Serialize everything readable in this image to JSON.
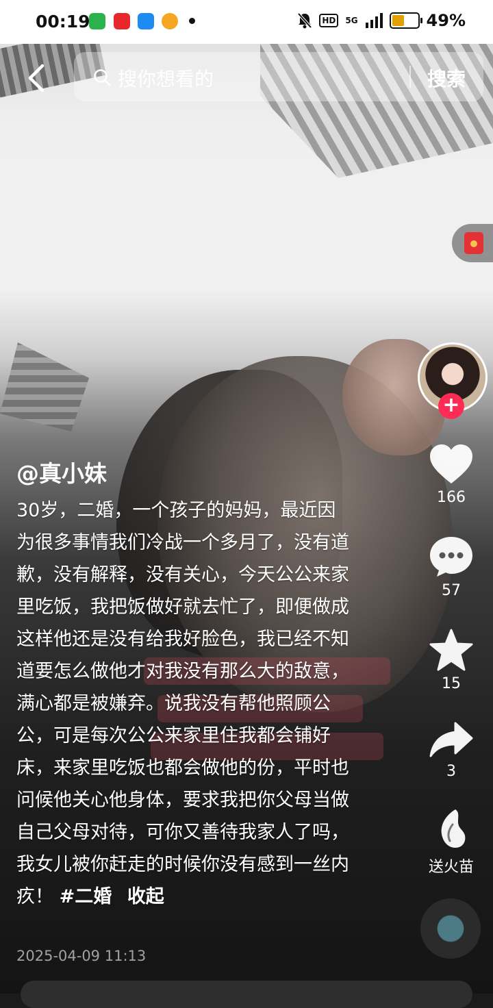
{
  "status_bar": {
    "time": "00:19",
    "network": "5G",
    "hd": "HD",
    "battery": "49%",
    "battery_level": 0.49
  },
  "search": {
    "placeholder": "搜你想看的",
    "button": "搜索"
  },
  "post": {
    "author": "@真小妹",
    "text": "30岁，二婚，一个孩子的妈妈，最近因为很多事情我们冷战一个多月了，没有道歉，没有解释，没有关心，今天公公来家里吃饭，我把饭做好就去忙了，即便做成这样他还是没有给我好脸色，我已经不知道要怎么做他才对我没有那么大的敌意，满心都是被嫌弃。说我没有帮他照顾公公，可是每次公公来家里住我都会铺好床，来家里吃饭也都会做他的份，平时也问候他关心他身体，要求我把你父母当做自己父母对待，可你又善待我家人了吗，我女儿被你赶走的时候你没有感到一丝内疚！",
    "hashtag": "#二婚",
    "collapse": "收起",
    "date": "2025-04-09 11:13"
  },
  "actions": {
    "likes": "166",
    "comments": "57",
    "favorites": "15",
    "shares": "3",
    "fire_label": "送火苗"
  },
  "colors": {
    "follow": "#fe2c55",
    "red_packet": "#e5262d"
  }
}
